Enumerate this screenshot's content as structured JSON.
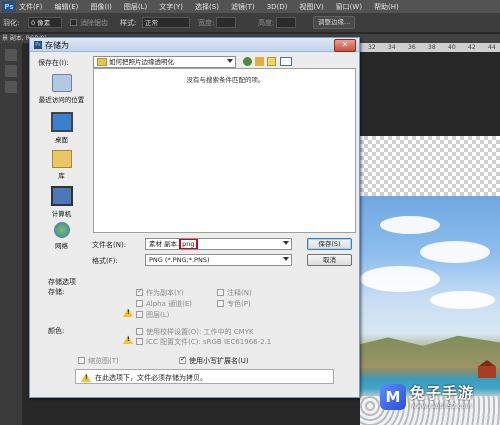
{
  "menubar": {
    "logo": "Ps",
    "items": [
      "文件(F)",
      "编辑(E)",
      "图像(I)",
      "图层(L)",
      "文字(Y)",
      "选择(S)",
      "滤镜(T)",
      "3D(D)",
      "视图(V)",
      "窗口(W)",
      "帮助(H)"
    ]
  },
  "options": {
    "feather_label": "羽化:",
    "feather_value": "0 像素",
    "antialias_label": "消除锯齿",
    "style_label": "样式:",
    "style_value": "正常",
    "width_label": "宽度:",
    "height_label": "高度:",
    "refine_button": "调整边缘..."
  },
  "doc_tab": "景 副本, RGB/8)",
  "ruler_ticks": [
    "32",
    "34",
    "36",
    "38",
    "40",
    "42",
    "44"
  ],
  "dialog": {
    "title": "存储为",
    "close_symbol": "✕",
    "save_in_label": "保存在(I):",
    "save_in_value": "如何把照片边缘透明化",
    "empty_message": "没有与搜索条件匹配的项。",
    "places": [
      "最近访问的位置",
      "桌面",
      "库",
      "计算机",
      "网络"
    ],
    "filename_label": "文件名(N):",
    "filename_prefix": "素材 副本.",
    "filename_ext": "png",
    "format_label": "格式(F):",
    "format_value": "PNG (*.PNG;*.PNS)",
    "save_button": "保存(S)",
    "cancel_button": "取消",
    "save_options_title": "存储选项",
    "store_label": "存储:",
    "opt_as_copy": "作为副本(Y)",
    "opt_notes": "注释(N)",
    "opt_alpha": "Alpha 通道(E)",
    "opt_spot": "专色(P)",
    "opt_layers": "图层(L)",
    "color_label": "颜色:",
    "opt_proof": "使用校样设置(O):  工作中的 CMYK",
    "opt_icc": "ICC 配置文件(C): sRGB IEC61966-2.1",
    "opt_thumbnail": "缩览图(T)",
    "opt_lowercase": "使用小写扩展名(U)",
    "warning_text": "在此选项下，文件必须存储为拷贝。"
  },
  "watermark": {
    "name": "兔子手游",
    "url": "www.rabbit52.com",
    "logo_char": "M"
  }
}
